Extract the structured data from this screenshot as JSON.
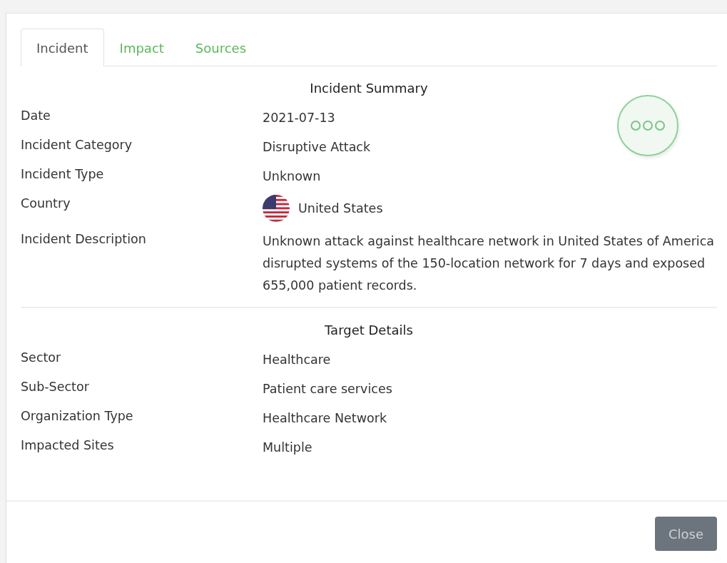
{
  "tabs": [
    {
      "label": "Incident",
      "selected": true
    },
    {
      "label": "Impact",
      "selected": false
    },
    {
      "label": "Sources",
      "selected": false
    }
  ],
  "sections": [
    {
      "title": "Incident Summary",
      "rows": [
        {
          "label": "Date",
          "value": "2021-07-13",
          "kind": "text"
        },
        {
          "label": "Incident Category",
          "value": "Disruptive Attack",
          "kind": "text"
        },
        {
          "label": "Incident Type",
          "value": "Unknown",
          "kind": "text"
        },
        {
          "label": "Country",
          "value": "United States",
          "kind": "flag"
        },
        {
          "label": "Incident Description",
          "value": "Unknown attack against healthcare network in United States of America disrupted systems of the 150-location network for 7 days and exposed 655,000 patient records.",
          "kind": "text"
        }
      ]
    },
    {
      "title": "Target Details",
      "rows": [
        {
          "label": "Sector",
          "value": "Healthcare",
          "kind": "text"
        },
        {
          "label": "Sub-Sector",
          "value": "Patient care services",
          "kind": "text"
        },
        {
          "label": "Organization Type",
          "value": "Healthcare Network",
          "kind": "text"
        },
        {
          "label": "Impacted Sites",
          "value": "Multiple",
          "kind": "text"
        }
      ]
    }
  ],
  "close_button": "Close"
}
